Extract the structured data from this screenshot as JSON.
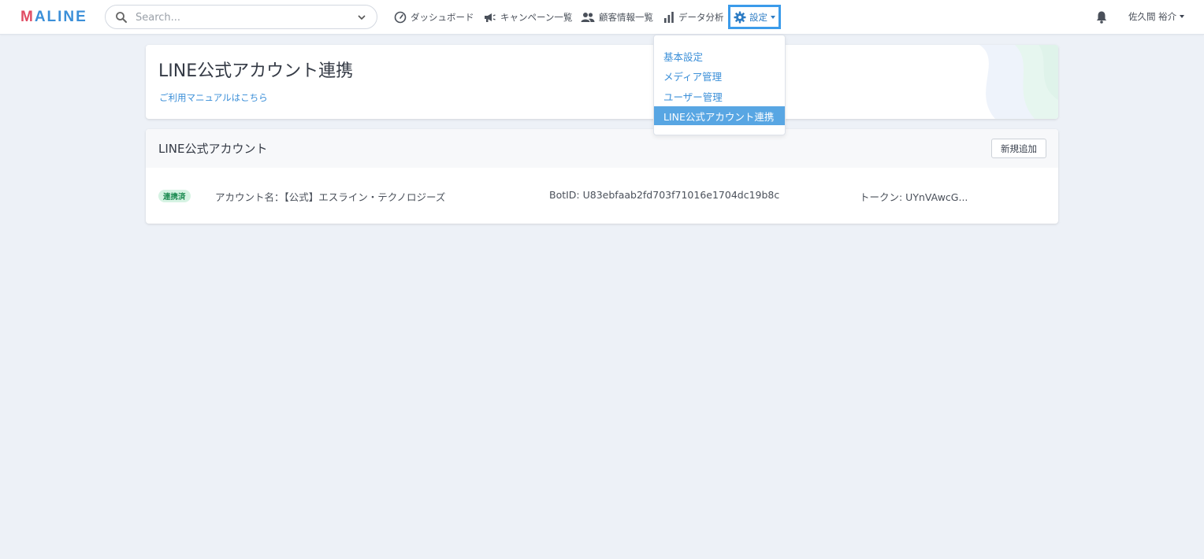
{
  "app": {
    "logo_text": "MALINE"
  },
  "search": {
    "placeholder": "Search..."
  },
  "nav": {
    "dashboard": "ダッシュボード",
    "campaigns": "キャンペーン一覧",
    "customers": "顧客情報一覧",
    "analytics": "データ分析",
    "settings": "設定"
  },
  "user": {
    "name": "佐久間 裕介"
  },
  "settings_menu": {
    "items": [
      {
        "label": "基本設定"
      },
      {
        "label": "メディア管理"
      },
      {
        "label": "ユーザー管理"
      },
      {
        "label": "LINE公式アカウント連携",
        "active": true
      }
    ]
  },
  "page": {
    "title": "LINE公式アカウント連携",
    "manual_link": "ご利用マニュアルはこちら"
  },
  "accounts_card": {
    "title": "LINE公式アカウント",
    "add_button": "新規追加",
    "rows": [
      {
        "status": "連携済",
        "account_name": "アカウント名：【公式】エスライン・テクノロジーズ",
        "bot_id": "BotID: U83ebfaab2fd703f71016e1704dc19b8c",
        "token": "トークン: UYnVAwcG..."
      }
    ]
  },
  "colors": {
    "accent": "#3b8fd8",
    "highlight_border": "#3b9bea",
    "success_bg": "#d6f3e3",
    "success_text": "#1b8a50",
    "background": "#edf1f7"
  }
}
